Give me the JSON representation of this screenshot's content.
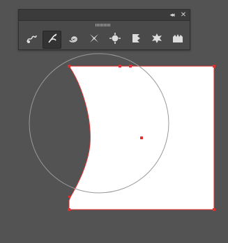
{
  "window": {
    "collapse_icon": "double-chevron-left-icon",
    "close_icon": "close-icon",
    "collapse_glyph": "◂◂",
    "close_glyph": "✕"
  },
  "tools": [
    {
      "name": "width-tool",
      "icon": "width-icon",
      "active": false
    },
    {
      "name": "warp-tool",
      "icon": "warp-icon",
      "active": true
    },
    {
      "name": "twirl-tool",
      "icon": "twirl-icon",
      "active": false
    },
    {
      "name": "pucker-tool",
      "icon": "pucker-icon",
      "active": false
    },
    {
      "name": "bloat-tool",
      "icon": "bloat-icon",
      "active": false
    },
    {
      "name": "scallop-tool",
      "icon": "scallop-icon",
      "active": false
    },
    {
      "name": "crystallize-tool",
      "icon": "crystallize-icon",
      "active": false
    },
    {
      "name": "wrinkle-tool",
      "icon": "wrinkle-icon",
      "active": false
    }
  ],
  "colors": {
    "canvas_background": "#535353",
    "panel_background": "#4a4a4a",
    "selection_red": "#e03030",
    "brush_outline": "#999999",
    "shape_fill": "#ffffff"
  }
}
